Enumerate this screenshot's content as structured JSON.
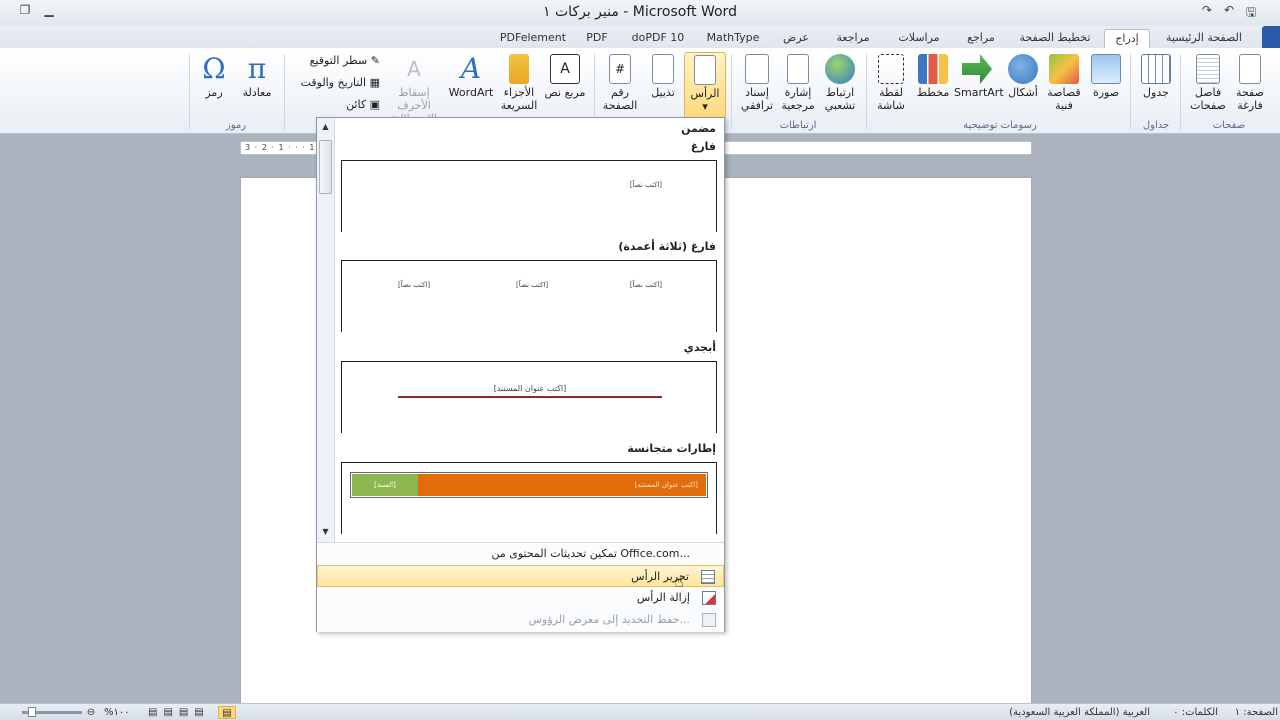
{
  "title": "منير بركات ١ - Microsoft Word",
  "tabs": [
    {
      "label": "الصفحة الرئيسية",
      "active": false
    },
    {
      "label": "إدراج",
      "active": true
    },
    {
      "label": "تخطيط الصفحة",
      "active": false
    },
    {
      "label": "مراجع",
      "active": false
    },
    {
      "label": "مراسلات",
      "active": false
    },
    {
      "label": "مراجعة",
      "active": false
    },
    {
      "label": "عرض",
      "active": false
    },
    {
      "label": "MathType",
      "active": false
    },
    {
      "label": "doPDF 10",
      "active": false
    },
    {
      "label": "PDF",
      "active": false
    },
    {
      "label": "PDFelement",
      "active": false
    }
  ],
  "ribbon": {
    "pages": {
      "blank_page": "صفحة فارغة",
      "page_break": "فاصل صفحات",
      "group": "صفحات"
    },
    "tables": {
      "table": "جدول",
      "group": "جداول"
    },
    "illustrations": {
      "picture": "صورة",
      "clip_art": "قصاصة فنية",
      "shapes": "أشكال",
      "smartart": "SmartArt",
      "chart": "مخطط",
      "screenshot": "لقطة شاشة",
      "group": "رسومات توضيحية"
    },
    "links": {
      "hyperlink": "ارتباط تشعبي",
      "bookmark": "إشارة مرجعية",
      "cross_reference": "إسناد ترافقي",
      "group": "ارتباطات"
    },
    "header_footer": {
      "header": "الرأس",
      "footer": "تذييل",
      "page_number": "رقم الصفحة"
    },
    "text": {
      "text_box": "مربع نص",
      "quick_parts": "الأجزاء السريعة",
      "wordart": "WordArt",
      "drop_cap": "إسقاط الأحرف الاستهلالية",
      "signature_line": "سطر التوقيع",
      "date_time": "التاريخ والوقت",
      "object": "كائن"
    },
    "symbols": {
      "equation": "معادلة",
      "symbol": "رمز",
      "group": "رموز"
    }
  },
  "gallery": {
    "section_builtin": "مضمن",
    "items": [
      {
        "name": "فارغ",
        "placeholders": [
          "[اكتب نصاً]"
        ]
      },
      {
        "name": "فارغ (ثلاثة أعمدة)",
        "placeholders": [
          "[اكتب نصاً]",
          "[اكتب نصاً]",
          "[اكتب نصاً]"
        ]
      },
      {
        "name": "أبجدي",
        "placeholders": [
          "[اكتب عنوان المستند]"
        ]
      },
      {
        "name": "إطارات متجانسة",
        "placeholders": [
          "[اكتب عنوان المستند]",
          "[السنة]"
        ]
      }
    ],
    "menu": [
      {
        "label": "تمكين تحديثات المحتوى من Office.com...",
        "highlighted": false,
        "disabled": false
      },
      {
        "label": "تحرير الرأس",
        "highlighted": true,
        "disabled": false
      },
      {
        "label": "إزالة الرأس",
        "highlighted": false,
        "disabled": false
      },
      {
        "label": "حفظ التحديد إلى معرض الرؤوس...",
        "highlighted": false,
        "disabled": true
      }
    ]
  },
  "ruler": {
    "text": "3 · 2 · 1 · · · 1 · 2 · 3 · 4 · · · 17 · 16"
  },
  "status": {
    "page": "الصفحة: ١ من ١",
    "words": "الكلمات: ٠",
    "language": "العربية (المملكة العربية السعودية)",
    "zoom": "%١٠٠"
  },
  "colors": {
    "accent": "#2a5aa8",
    "header_orange": "#e36c0a",
    "header_green": "#8db650",
    "header_line": "#8b2a2a"
  }
}
